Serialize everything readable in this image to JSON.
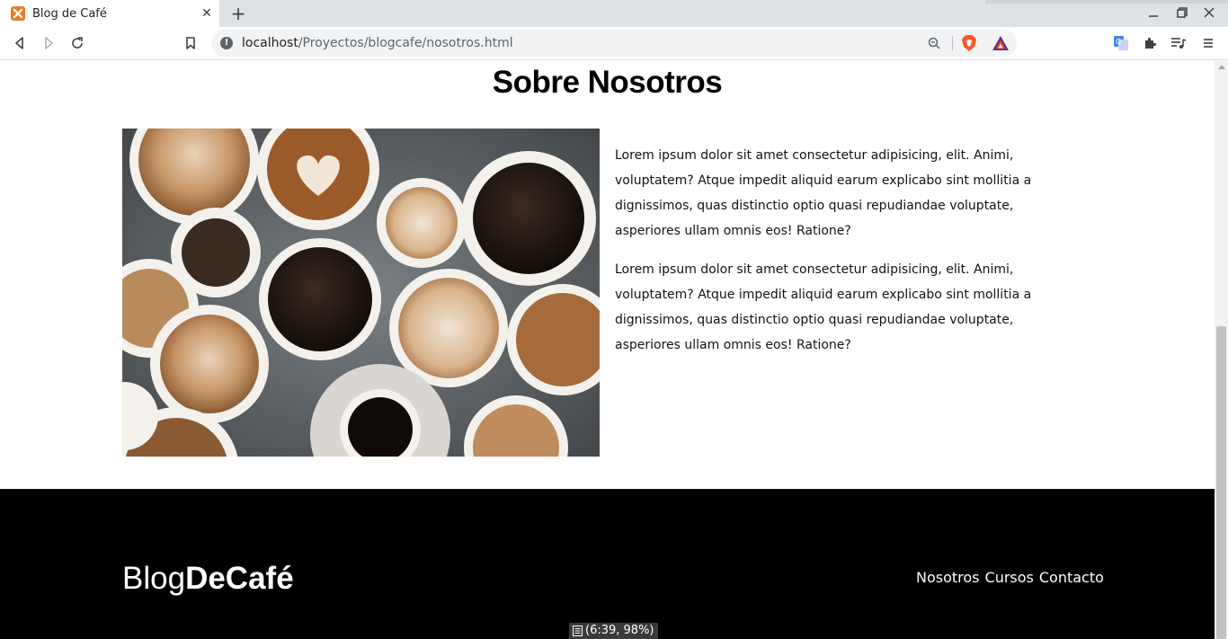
{
  "browser": {
    "tab_title": "Blog de Café",
    "url_host": "localhost",
    "url_path": "/Proyectos/blogcafe/nosotros.html"
  },
  "page": {
    "heading": "Sobre Nosotros",
    "paragraphs": [
      "Lorem ipsum dolor sit amet consectetur adipisicing, elit. Animi, voluptatem? Atque impedit aliquid earum explicabo sint mollitia a dignissimos, quas distinctio optio quasi repudiandae voluptate, asperiores ullam omnis eos! Ratione?",
      "Lorem ipsum dolor sit amet consectetur adipisicing, elit. Animi, voluptatem? Atque impedit aliquid earum explicabo sint mollitia a dignissimos, quas distinctio optio quasi repudiandae voluptate, asperiores ullam omnis eos! Ratione?"
    ]
  },
  "footer": {
    "logo_light": "Blog",
    "logo_bold": "DeCafé",
    "nav": [
      "Nosotros",
      "Cursos",
      "Contacto"
    ]
  },
  "status": {
    "text": "(6:39, 98%)"
  }
}
